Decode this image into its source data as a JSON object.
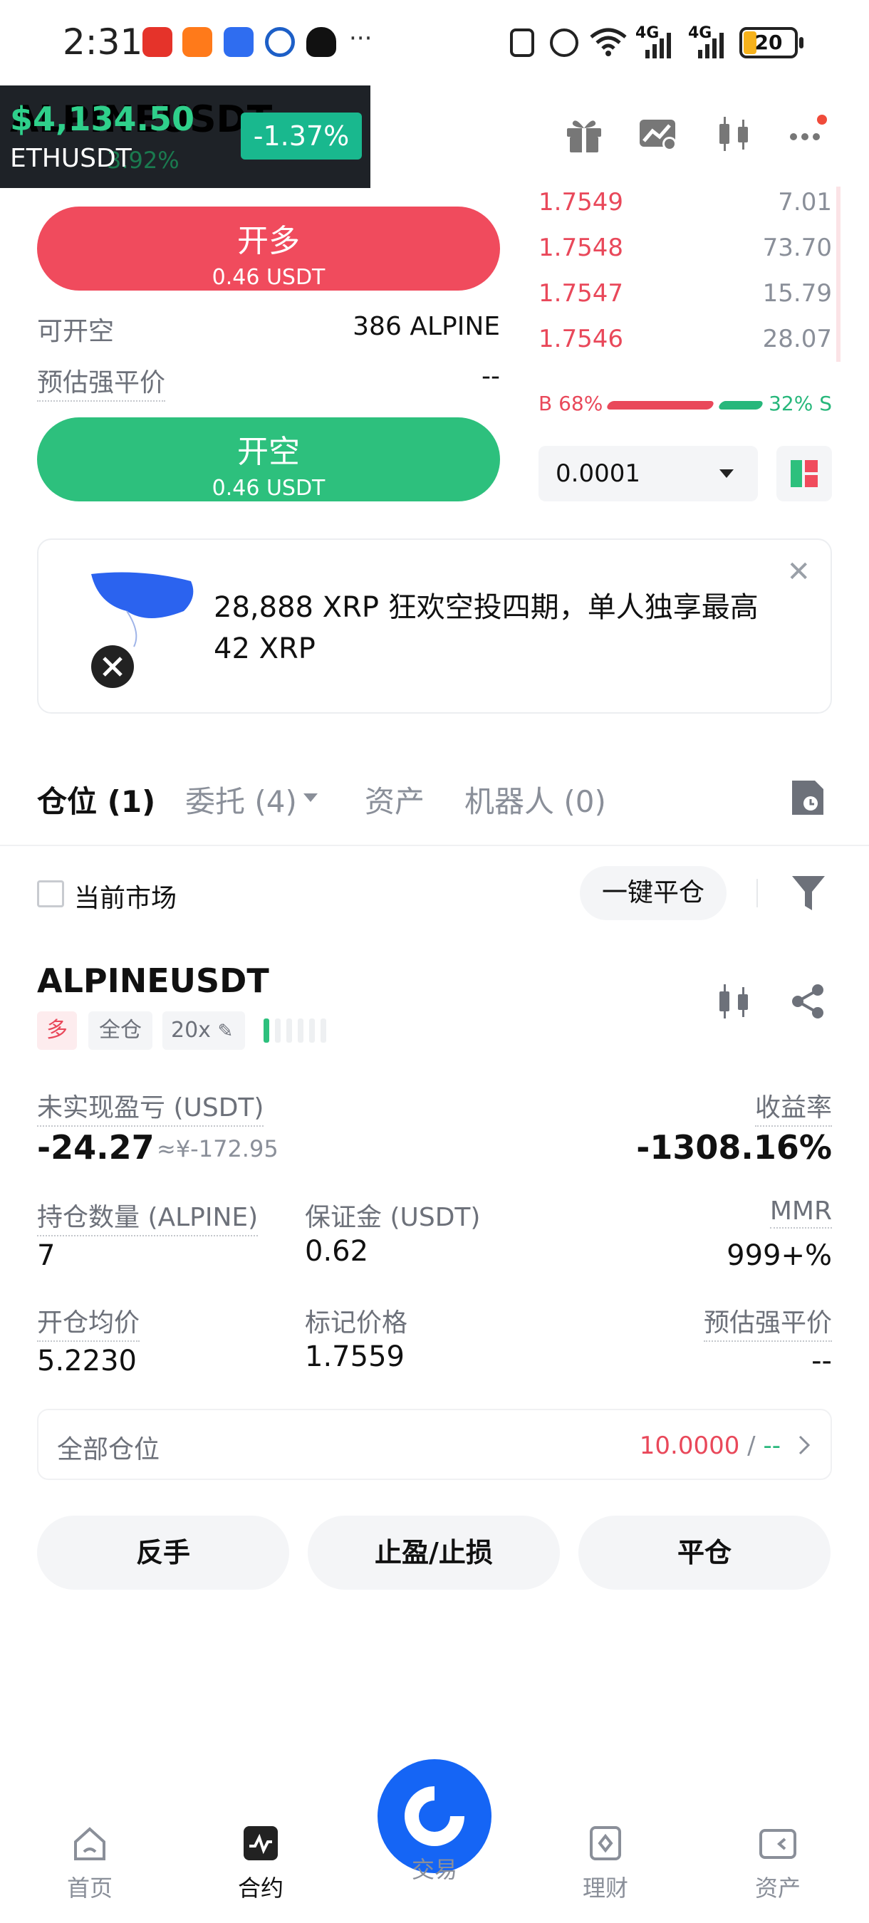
{
  "status_bar": {
    "time": "2:31",
    "overflow": "···",
    "network": "4G",
    "battery": "20"
  },
  "ticker_overlay": {
    "price": "$4,134.50",
    "symbol": "ETHUSDT",
    "change": "-1.37%",
    "underlying_symbol": "ALPINEUSDT",
    "underlying_change": "3.92%"
  },
  "order_panel": {
    "buy_label": "开多",
    "buy_amount": "0.46 USDT",
    "sell_label": "开空",
    "sell_amount": "0.46 USDT",
    "available_label": "可开空",
    "available_value": "386 ALPINE",
    "liq_label": "预估强平价",
    "liq_value": "--"
  },
  "order_book": {
    "asks": [
      {
        "price": "1.7549",
        "qty": "7.01"
      },
      {
        "price": "1.7548",
        "qty": "73.70"
      },
      {
        "price": "1.7547",
        "qty": "15.79"
      },
      {
        "price": "1.7546",
        "qty": "28.07"
      }
    ],
    "buy_ratio": "B 68%",
    "sell_ratio": "32% S",
    "precision": "0.0001"
  },
  "banner": {
    "text": "28,888 XRP 狂欢空投四期，单人独享最高 42 XRP",
    "close": "✕"
  },
  "tabs": [
    {
      "label": "仓位 (1)",
      "active": true
    },
    {
      "label": "委托 (4)",
      "active": false
    },
    {
      "label": "资产",
      "active": false
    },
    {
      "label": "机器人 (0)",
      "active": false
    }
  ],
  "filter": {
    "current_market_label": "当前市场",
    "close_all_label": "一键平仓"
  },
  "position": {
    "symbol": "ALPINEUSDT",
    "side_tag": "多",
    "margin_tag": "全仓",
    "leverage_tag": "20x",
    "pnl_label": "未实现盈亏 (USDT)",
    "pnl_value": "-24.27",
    "pnl_cny": "≈¥-172.95",
    "roe_label": "收益率",
    "roe_value": "-1308.16%",
    "qty_label": "持仓数量 (ALPINE)",
    "qty_value": "7",
    "margin_label": "保证金 (USDT)",
    "margin_value": "0.62",
    "mmr_label": "MMR",
    "mmr_value": "999+%",
    "entry_label": "开仓均价",
    "entry_value": "5.2230",
    "mark_label": "标记价格",
    "mark_value": "1.7559",
    "liq_label": "预估强平价",
    "liq_value": "--",
    "all_positions_label": "全部仓位",
    "tp_value": "10.0000",
    "sep": " / ",
    "sl_value": "--"
  },
  "actions": {
    "reverse": "反手",
    "tpsl": "止盈/止损",
    "close": "平仓"
  },
  "bottom_nav": {
    "home": "首页",
    "futures": "合约",
    "trade": "交易",
    "earn": "理财",
    "assets": "资产"
  },
  "colors": {
    "buy_red": "#f04b5d",
    "sell_green": "#2dc07d",
    "brand_blue": "#1565f5"
  }
}
